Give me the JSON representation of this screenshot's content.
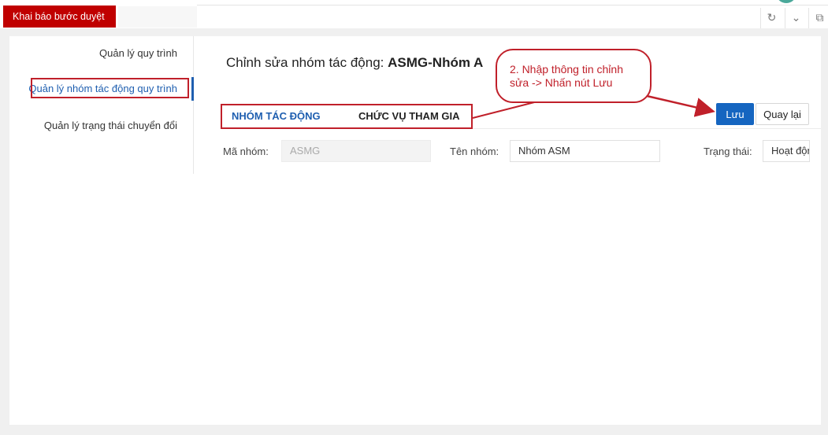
{
  "header": {
    "title": "Khai báo bước duyệt",
    "icons": [
      "refresh-icon",
      "chevron-down-icon",
      "fullscreen-icon"
    ]
  },
  "sidebar": {
    "items": [
      {
        "label": "Quản lý quy trình",
        "active": false
      },
      {
        "label": "Quản lý nhóm tác động quy trình",
        "active": true
      },
      {
        "label": "Quản lý trạng thái chuyển đổi",
        "active": false
      }
    ]
  },
  "main": {
    "title_prefix": "Chỉnh sửa nhóm tác động: ",
    "title_value": "ASMG-Nhóm A",
    "tabs": [
      {
        "label": "NHÓM TÁC ĐỘNG",
        "active": true
      },
      {
        "label": "CHỨC VỤ THAM GIA",
        "active": false
      }
    ],
    "buttons": {
      "save": "Lưu",
      "back": "Quay lại"
    },
    "fields": {
      "group_code_label": "Mã nhóm:",
      "group_code_value": "ASMG",
      "group_name_label": "Tên nhóm:",
      "group_name_value": "Nhóm ASM",
      "status_label": "Trạng thái:",
      "status_value": "Hoạt động"
    }
  },
  "annotation": {
    "line1": "2. Nhập thông tin chỉnh",
    "line2": "sửa -> Nhấn nút Lưu"
  },
  "colors": {
    "brand_red": "#c00000",
    "primary_blue": "#1565c0",
    "annotation_red": "#c0202a"
  }
}
